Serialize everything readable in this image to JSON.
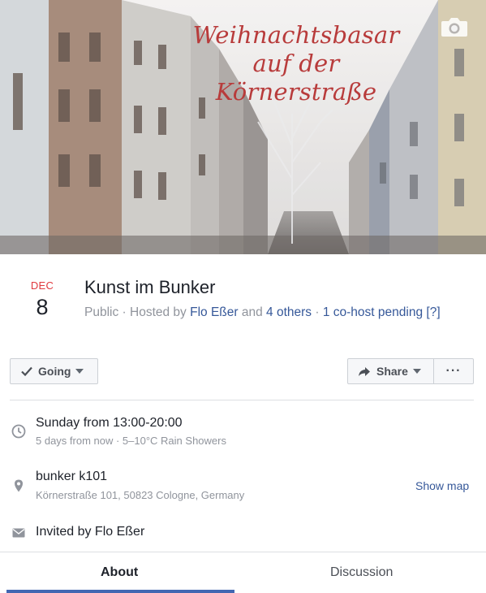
{
  "cover": {
    "title_line1": "Weihnachtsbasar",
    "title_line2": "auf der",
    "title_line3": "Körnerstraße"
  },
  "event": {
    "month": "DEC",
    "day": "8",
    "title": "Kunst im Bunker",
    "privacy": "Public",
    "hosted_by_prefix": "Hosted by",
    "host": "Flo Eßer",
    "and_text": "and",
    "others": "4 others",
    "cohost_pending": "1 co-host pending",
    "help_link": "[?]"
  },
  "actions": {
    "going_label": "Going",
    "share_label": "Share",
    "more_label": "···"
  },
  "details": {
    "time_main": "Sunday from 13:00-20:00",
    "time_sub": "5 days from now · 5–10°C Rain Showers",
    "location_name": "bunker k101",
    "location_address": "Körnerstraße 101, 50823 Cologne, Germany",
    "show_map": "Show map",
    "invited": "Invited by Flo Eßer"
  },
  "tabs": [
    {
      "label": "About",
      "active": true
    },
    {
      "label": "Discussion",
      "active": false
    }
  ],
  "colors": {
    "accent": "#4267b2",
    "link": "#365899",
    "date_month": "#e0393e",
    "muted_text": "#90949c"
  }
}
